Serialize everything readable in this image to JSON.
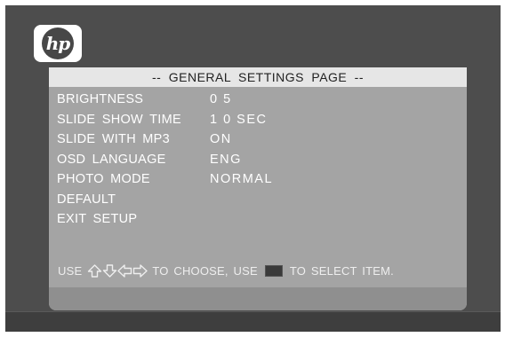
{
  "brand": {
    "logo_text": "hp"
  },
  "title": "-- GENERAL SETTINGS PAGE --",
  "menu": [
    {
      "label": "BRIGHTNESS",
      "value": "0 5"
    },
    {
      "label": "SLIDE SHOW TIME",
      "value": "1 0 SEC"
    },
    {
      "label": "SLIDE WITH MP3",
      "value": "ON"
    },
    {
      "label": "OSD LANGUAGE",
      "value": "ENG"
    },
    {
      "label": "PHOTO MODE",
      "value": "NORMAL"
    },
    {
      "label": "DEFAULT",
      "value": ""
    },
    {
      "label": "EXIT SETUP",
      "value": ""
    }
  ],
  "hint": {
    "prefix": "USE",
    "middle": "TO CHOOSE, USE",
    "suffix": "TO SELECT ITEM.",
    "arrow_icons": [
      "up-arrow-icon",
      "down-arrow-icon",
      "left-arrow-icon",
      "right-arrow-icon"
    ],
    "select_icon": "enter-key-icon"
  },
  "colors": {
    "screen_bg": "#4d4d4d",
    "panel_bg": "#a4a4a4",
    "title_bar_bg": "#e6e6e6",
    "menu_text": "#ffffff"
  }
}
